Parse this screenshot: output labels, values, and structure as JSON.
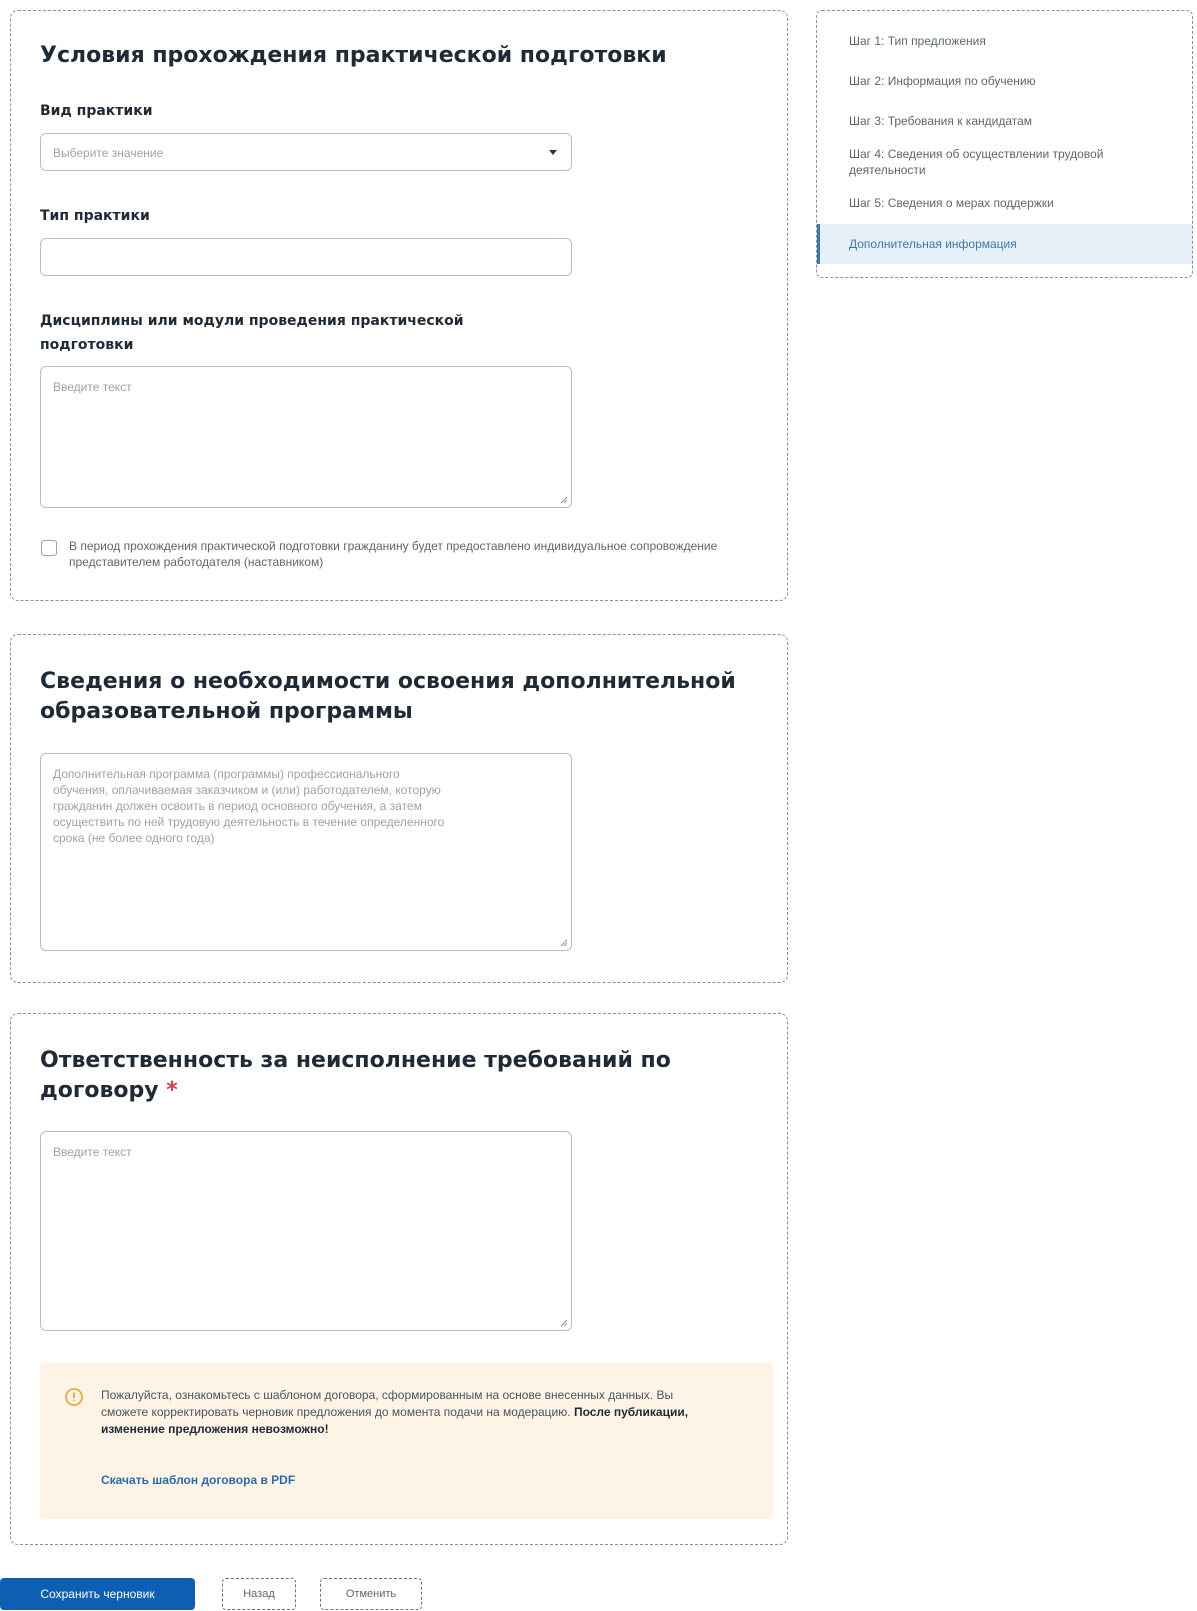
{
  "section_practice": {
    "title": "Условия прохождения практической подготовки",
    "practice_kind_label": "Вид практики",
    "practice_kind_placeholder": "Выберите значение",
    "practice_type_label": "Тип практики",
    "practice_type_value": "",
    "disciplines_label": "Дисциплины или модули проведения практической подготовки",
    "disciplines_placeholder": "Введите текст",
    "mentor_checkbox_label": "В период прохождения практической подготовки гражданину будет предоставлено индивидуальное сопровождение представителем работодателя (наставником)",
    "mentor_checked": false
  },
  "section_additional_program": {
    "title": "Сведения о необходимости освоения дополнительной образовательной программы",
    "placeholder": "Дополнительная программа (программы) профессионального обучения, оплачиваемая заказчиком и (или) работодателем, которую гражданин должен освоить в период основного обучения, а затем    осуществить по ней трудовую деятельность в течение определенного срока (не более одного года)"
  },
  "section_liability": {
    "title": "Ответственность за неисполнение требований по договору",
    "required_mark": "*",
    "placeholder": "Введите текст",
    "notice_text": "Пожалуйста, ознакомьтесь с шаблоном договора, сформированным на основе внесенных данных.  Вы сможете корректировать черновик предложения до момента подачи на модерацию.",
    "notice_bold": "После публикации, изменение предложения невозможно!",
    "notice_link": "Скачать шаблон договора в PDF"
  },
  "steps_nav": {
    "items": [
      "Шаг 1: Тип предложения",
      "Шаг 2: Информация по обучению",
      "Шаг 3: Требования к кандидатам",
      "Шаг 4: Сведения об осуществлении трудовой деятельности",
      "Шаг 5: Сведения о мерах поддержки",
      "Дополнительная информация"
    ],
    "active_index": 5
  },
  "footer": {
    "save_draft": "Сохранить черновик",
    "back": "Назад",
    "cancel": "Отменить"
  },
  "colors": {
    "primary": "#0d5fb3",
    "active_nav_bg": "#e6f0f9",
    "notice_bg": "#fdf4e5",
    "notice_icon": "#e8a31c",
    "required": "#e03a3a"
  }
}
